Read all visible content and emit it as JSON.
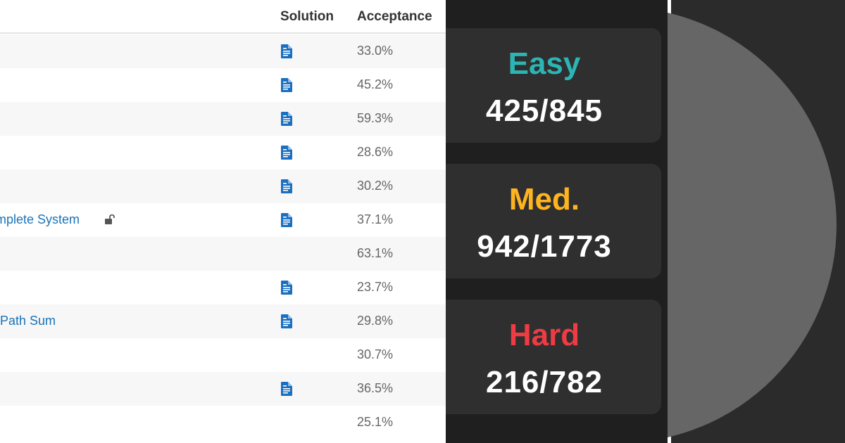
{
  "table": {
    "columns": {
      "solution": "Solution",
      "acceptance": "Acceptance"
    },
    "rows": [
      {
        "title": "",
        "has_solution": true,
        "acceptance": "33.0%",
        "locked": false
      },
      {
        "title": "",
        "has_solution": true,
        "acceptance": "45.2%",
        "locked": false
      },
      {
        "title": "",
        "has_solution": true,
        "acceptance": "59.3%",
        "locked": false
      },
      {
        "title": "",
        "has_solution": true,
        "acceptance": "28.6%",
        "locked": false
      },
      {
        "title": "",
        "has_solution": true,
        "acceptance": "30.2%",
        "locked": false
      },
      {
        "title": "mplete System",
        "has_solution": true,
        "acceptance": "37.1%",
        "locked": true
      },
      {
        "title": "",
        "has_solution": false,
        "acceptance": "63.1%",
        "locked": false
      },
      {
        "title": "",
        "has_solution": true,
        "acceptance": "23.7%",
        "locked": false
      },
      {
        "title": "Path Sum",
        "has_solution": true,
        "acceptance": "29.8%",
        "locked": false
      },
      {
        "title": "",
        "has_solution": false,
        "acceptance": "30.7%",
        "locked": false
      },
      {
        "title": "",
        "has_solution": true,
        "acceptance": "36.5%",
        "locked": false
      },
      {
        "title": "",
        "has_solution": false,
        "acceptance": "25.1%",
        "locked": false
      }
    ]
  },
  "stats": {
    "easy": {
      "label": "Easy",
      "count": "425/845",
      "color": "#2cb5b5"
    },
    "medium": {
      "label": "Med.",
      "count": "942/1773",
      "color": "#ffb41f"
    },
    "hard": {
      "label": "Hard",
      "count": "216/782",
      "color": "#ef3b43"
    }
  },
  "colors": {
    "link": "#1a73b8",
    "solution_icon": "#1b6fc0"
  }
}
